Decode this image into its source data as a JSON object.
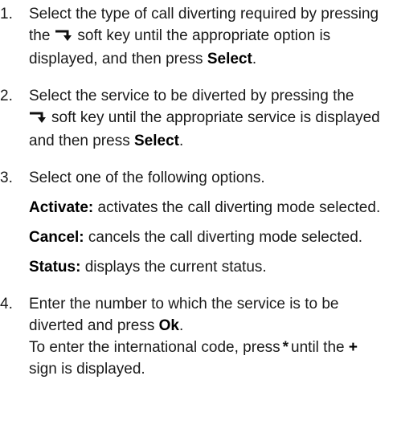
{
  "steps": [
    {
      "number": "1.",
      "before_icon": "Select the type of call diverting required by pressing the",
      "icon": "down-arrow-softkey-icon",
      "after_icon": "soft key until the appropriate option is displayed, and then press",
      "bold": "Select",
      "end": "."
    },
    {
      "number": "2.",
      "before_icon": "Select the service to be diverted by pressing the",
      "icon": "down-arrow-softkey-icon",
      "after_icon": "soft key until the appropriate service is displayed and then press",
      "bold": "Select",
      "end": "."
    },
    {
      "number": "3.",
      "text": "Select one of the following options.",
      "options": [
        {
          "term": "Activate:",
          "desc": "activates the call diverting mode selected."
        },
        {
          "term": "Cancel:",
          "desc": "cancels the call diverting mode selected."
        },
        {
          "term": "Status:",
          "desc": "displays the current status."
        }
      ]
    },
    {
      "number": "4.",
      "text": "Enter the number to which the service is to be diverted and press",
      "bold": "Ok",
      "end": ".",
      "note_before": "To enter the international code, press",
      "star": "*",
      "note_middle": "until the",
      "plus": "+",
      "note_after": "sign is displayed."
    }
  ]
}
